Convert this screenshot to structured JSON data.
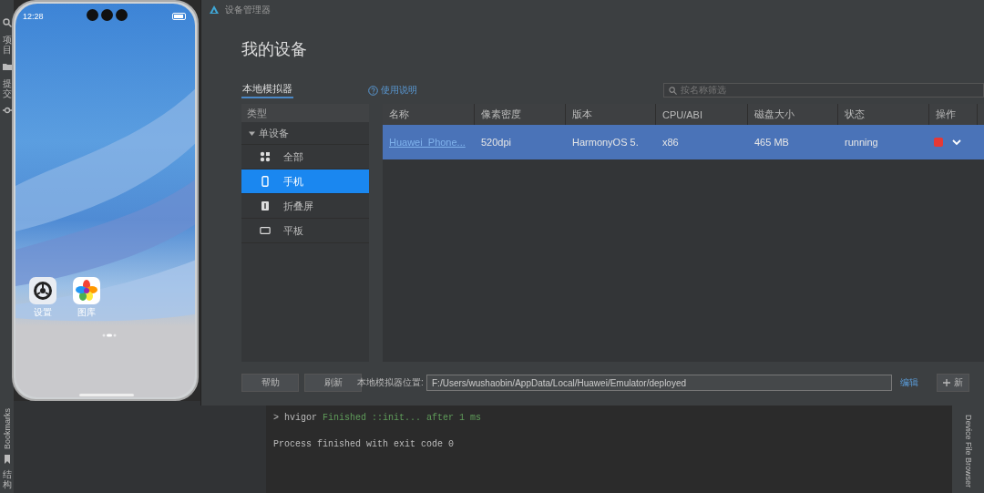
{
  "ide": {
    "left_toolbar": [
      {
        "label": "项目",
        "kind": "folder"
      },
      {
        "label": "提交",
        "kind": "commit"
      }
    ],
    "bottom_left_toolbar": [
      {
        "label": "Bookmarks",
        "kind": "rotated"
      },
      {
        "label": "结构",
        "kind": "stacked"
      }
    ],
    "right_toolbar": [
      {
        "label": "Device File Browser"
      }
    ]
  },
  "phone": {
    "time": "12:28",
    "apps": [
      {
        "label": "设置",
        "kind": "gear"
      },
      {
        "label": "图库",
        "kind": "flower"
      }
    ]
  },
  "dialog": {
    "title": "设备管理器",
    "heading": "我的设备",
    "tab": "本地模拟器",
    "help_link": "使用说明",
    "search": {
      "placeholder": "按名称筛选"
    },
    "categories": {
      "header": "类型",
      "groups": [
        {
          "label": "单设备",
          "expanded": true,
          "children": [
            {
              "label": "全部",
              "kind": "grid",
              "selected": false
            },
            {
              "label": "手机",
              "kind": "phone",
              "selected": true
            },
            {
              "label": "折叠屏",
              "kind": "foldable",
              "selected": false
            },
            {
              "label": "平板",
              "kind": "tablet",
              "selected": false
            }
          ]
        }
      ]
    },
    "table": {
      "columns": [
        "名称",
        "像素密度",
        "版本",
        "CPU/ABI",
        "磁盘大小",
        "状态",
        "操作"
      ],
      "rows": [
        {
          "selected": true,
          "name": "Huawei_Phone...",
          "density": "520dpi",
          "version": "HarmonyOS 5.",
          "cpu": "x86",
          "disk": "465 MB",
          "status": "running",
          "running": true
        }
      ]
    },
    "footer": {
      "buttons": [
        "帮助",
        "刷新"
      ],
      "location_label": "本地模拟器位置:",
      "location": "F:/Users/wushaobin/AppData/Local/Huawei/Emulator/deployed",
      "edit_link": "编辑",
      "new_button": "新"
    }
  },
  "console": {
    "lines": [
      {
        "kind": "task",
        "prompt": ">",
        "tool": "hvigor",
        "message": "Finished ::init... after 1 ms"
      },
      {
        "kind": "plain",
        "text": "Process finished with exit code 0"
      }
    ]
  }
}
